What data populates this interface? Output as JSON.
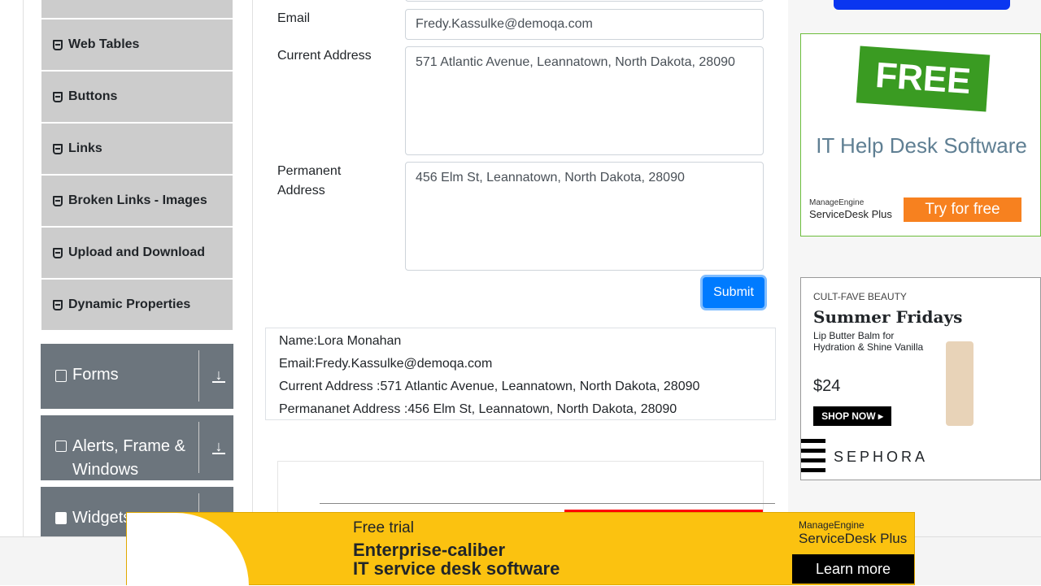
{
  "sidebar": {
    "items": [
      {
        "label": "Web Tables"
      },
      {
        "label": "Buttons"
      },
      {
        "label": "Links"
      },
      {
        "label": "Broken Links - Images"
      },
      {
        "label": "Upload and Download"
      },
      {
        "label": "Dynamic Properties"
      }
    ],
    "groups": [
      {
        "label": "Forms"
      },
      {
        "label": "Alerts, Frame & Windows"
      },
      {
        "label": "Widgets"
      }
    ]
  },
  "form": {
    "email_label": "Email",
    "email_value": "Fredy.Kassulke@demoqa.com",
    "current_label": "Current Address",
    "current_value": "571 Atlantic Avenue, Leannatown, North Dakota, 28090",
    "permanent_label": "Permanent Address",
    "permanent_value": "456 Elm St, Leannatown, North Dakota, 28090",
    "submit": "Submit"
  },
  "output": {
    "name": "Name:Lora Monahan",
    "email": "Email:Fredy.Kassulke@demoqa.com",
    "current": "Current Address :571 Atlantic Avenue, Leannatown, North Dakota, 28090",
    "permanent": "Permananet Address :456 Elm St, Leannatown, North Dakota, 28090"
  },
  "ads": {
    "free": {
      "badge": "FREE",
      "title": "IT Help Desk Software",
      "brand1": "ManageEngine",
      "brand2": "ServiceDesk Plus",
      "cta": "Try for free"
    },
    "sephora": {
      "brand": "CULT-FAVE BEAUTY",
      "title": "Summer Fridays",
      "desc": "Lip Butter Balm for Hydration & Shine Vanilla",
      "price": "$24",
      "cta": "SHOP NOW ▸",
      "store": "SEPHORA"
    },
    "bottom": {
      "line1": "Free trial",
      "line2": "Enterprise-caliber",
      "line3": "IT service desk software",
      "brand1": "ManageEngine",
      "brand2": "ServiceDesk Plus",
      "cta": "Learn more"
    }
  }
}
